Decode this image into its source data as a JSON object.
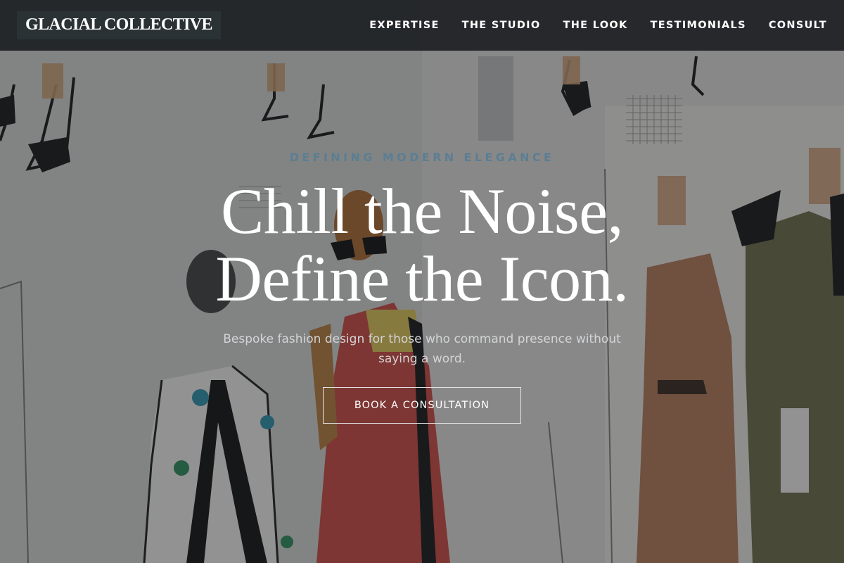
{
  "header": {
    "logo": "GLACIAL COLLECTIVE",
    "nav": [
      {
        "label": "EXPERTISE"
      },
      {
        "label": "THE STUDIO"
      },
      {
        "label": "THE LOOK"
      },
      {
        "label": "TESTIMONIALS"
      },
      {
        "label": "CONSULT"
      }
    ]
  },
  "hero": {
    "eyebrow": "DEFINING MODERN ELEGANCE",
    "headline_line1": "Chill the Noise,",
    "headline_line2": "Define the Icon.",
    "subtext": "Bespoke fashion design for those who command presence without saying a word.",
    "cta_label": "BOOK A CONSULTATION",
    "background": "fashion-sketches-illustration"
  },
  "colors": {
    "accent": "#5b7e93",
    "header_bg": "#16181c",
    "logo_bg": "#2b3236",
    "text_primary": "#ffffff"
  }
}
